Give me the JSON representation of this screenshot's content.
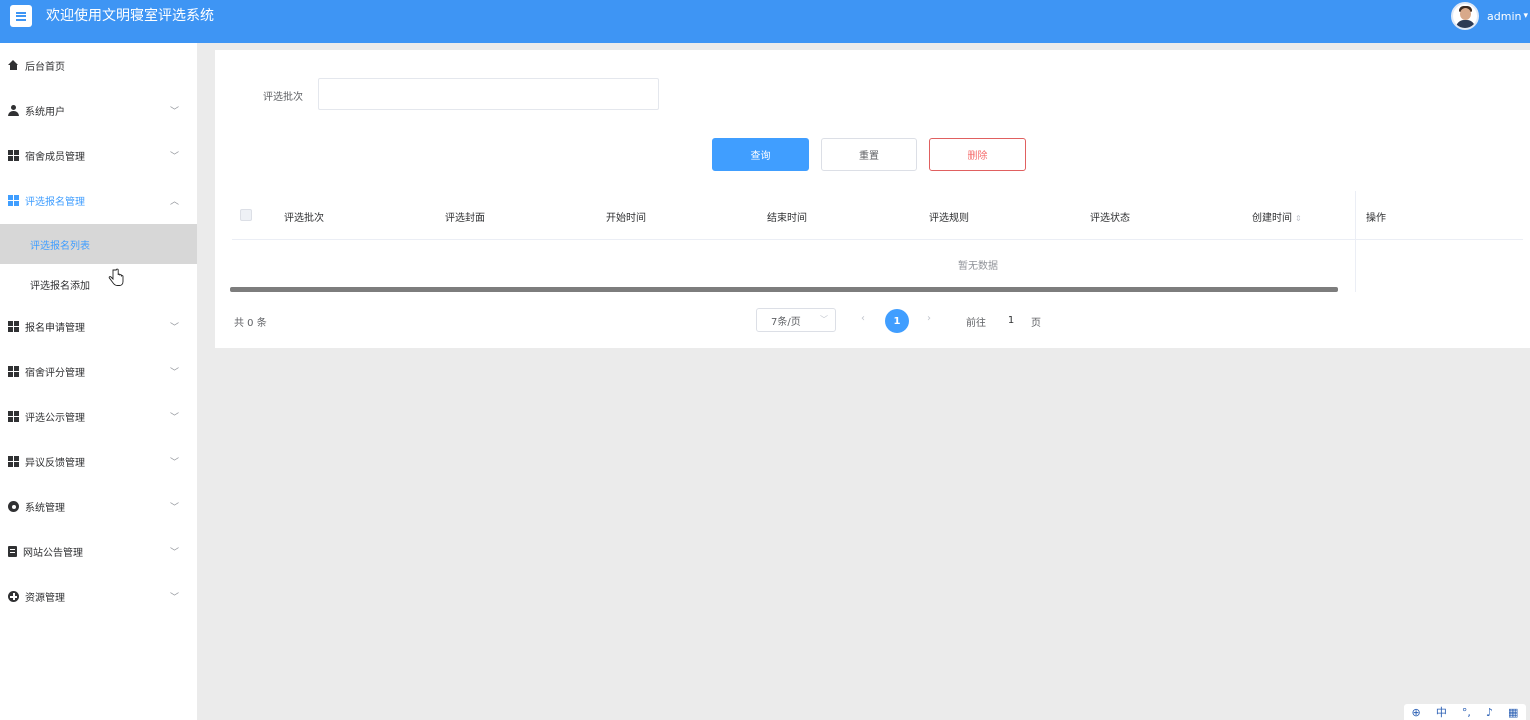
{
  "header": {
    "title": "欢迎使用文明寝室评选系统",
    "username": "admin",
    "caret": "▾"
  },
  "sidebar": {
    "items": [
      {
        "label": "后台首页",
        "arrow": ""
      },
      {
        "label": "系统用户",
        "arrow": "﹀"
      },
      {
        "label": "宿舍成员管理",
        "arrow": "﹀"
      },
      {
        "label": "评选报名管理",
        "arrow": "︿"
      },
      {
        "label": "报名申请管理",
        "arrow": "﹀"
      },
      {
        "label": "宿舍评分管理",
        "arrow": "﹀"
      },
      {
        "label": "评选公示管理",
        "arrow": "﹀"
      },
      {
        "label": "异议反馈管理",
        "arrow": "﹀"
      },
      {
        "label": "系统管理",
        "arrow": "﹀"
      },
      {
        "label": "网站公告管理",
        "arrow": "﹀"
      },
      {
        "label": "资源管理",
        "arrow": "﹀"
      }
    ],
    "sub_items": [
      {
        "label": "评选报名列表"
      },
      {
        "label": "评选报名添加"
      }
    ]
  },
  "search": {
    "label": "评选批次",
    "value": "",
    "placeholder": ""
  },
  "buttons": {
    "query": "查询",
    "reset": "重置",
    "delete": "删除"
  },
  "table": {
    "columns": [
      "评选批次",
      "评选封面",
      "开始时间",
      "结束时间",
      "评选规则",
      "评选状态",
      "创建时间"
    ],
    "sort_icon": "⇕",
    "action_column": "操作",
    "empty_text": "暂无数据"
  },
  "pagination": {
    "total": "共 0 条",
    "page_size": "7条/页",
    "current_page": "1",
    "goto_label": "前往",
    "goto_value": "1",
    "page_unit": "页",
    "prev": "‹",
    "next": "›"
  },
  "colors": {
    "header_bg": "#3e95f4",
    "primary": "#409eff",
    "danger": "#f56c6c",
    "selected_bg": "#d7d7d7"
  }
}
